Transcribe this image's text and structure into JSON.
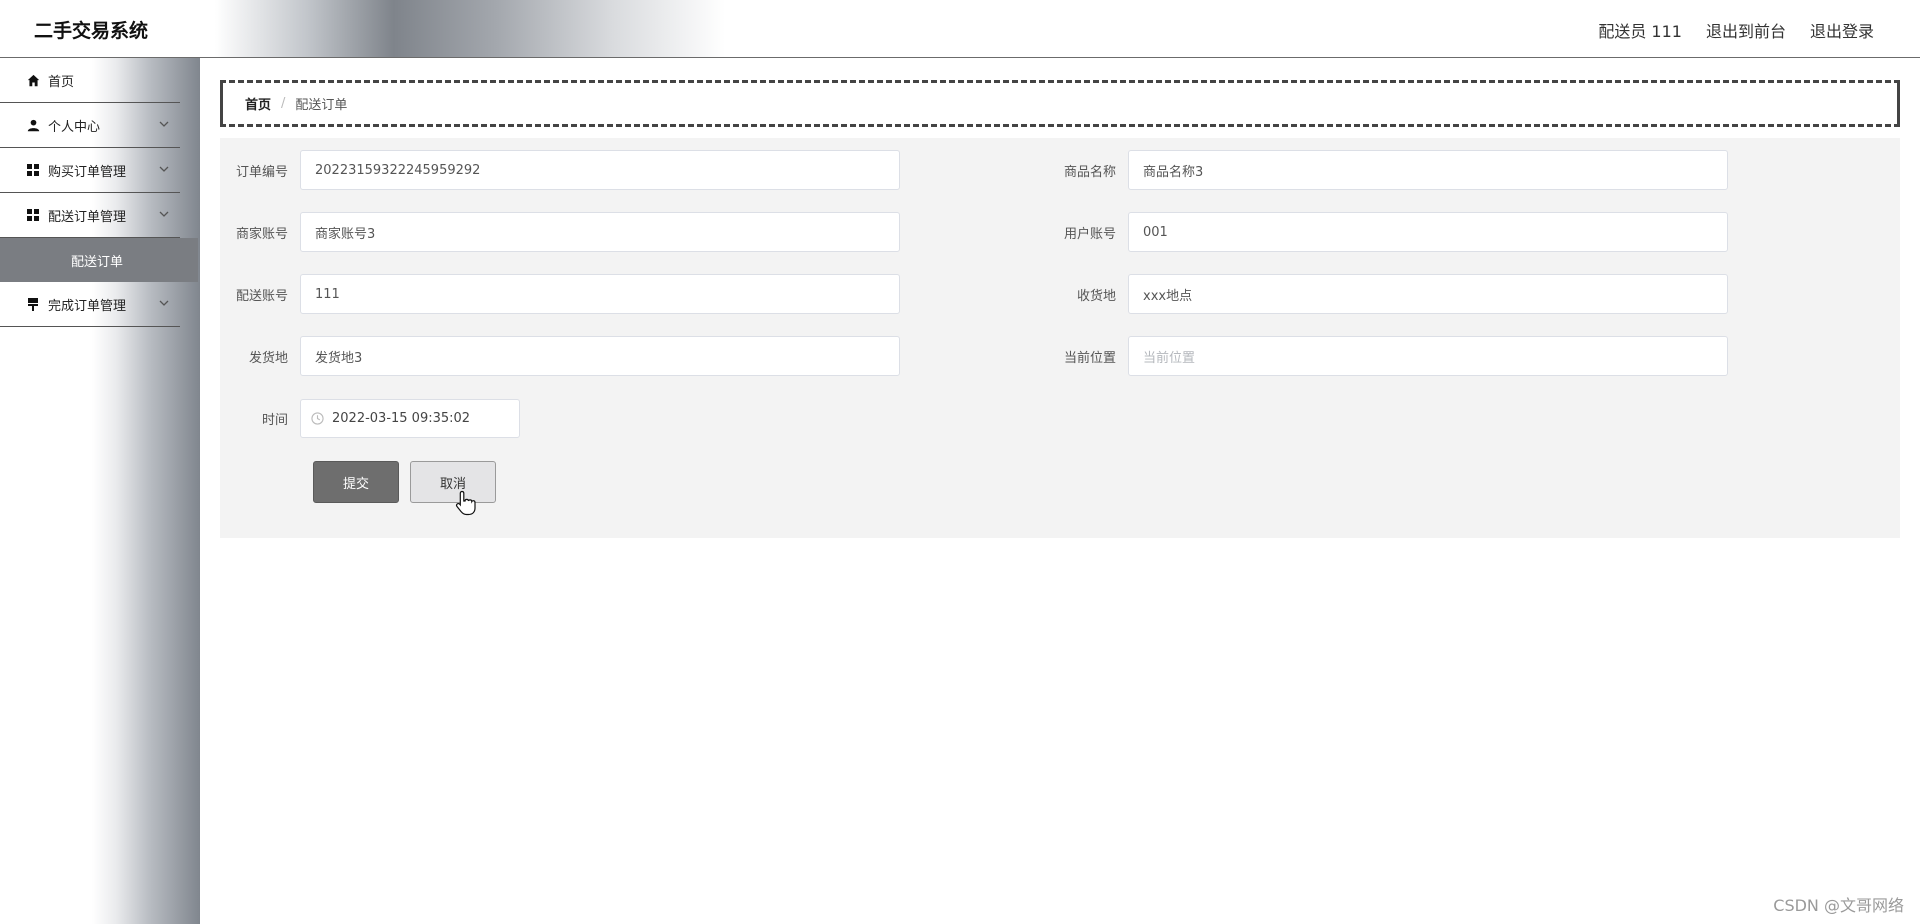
{
  "header": {
    "app_title": "二手交易系统",
    "user_label": "配送员 111",
    "back_to_front": "退出到前台",
    "logout": "退出登录"
  },
  "sidebar": {
    "items": [
      {
        "label": "首页",
        "icon": "home-icon"
      },
      {
        "label": "个人中心",
        "icon": "user-icon"
      },
      {
        "label": "购买订单管理",
        "icon": "grid-icon"
      },
      {
        "label": "配送订单管理",
        "icon": "grid-icon",
        "expanded": true
      },
      {
        "label": "完成订单管理",
        "icon": "flag-icon"
      }
    ],
    "subitem_active": "配送订单"
  },
  "breadcrumb": {
    "home": "首页",
    "separator": "/",
    "current": "配送订单"
  },
  "form": {
    "order_no": {
      "label": "订单编号",
      "value": "20223159322245959292"
    },
    "product_name": {
      "label": "商品名称",
      "value": "商品名称3"
    },
    "merchant_account": {
      "label": "商家账号",
      "value": "商家账号3"
    },
    "user_account": {
      "label": "用户账号",
      "value": "001"
    },
    "delivery_account": {
      "label": "配送账号",
      "value": "111"
    },
    "receive_address": {
      "label": "收货地",
      "value": "xxx地点"
    },
    "ship_address": {
      "label": "发货地",
      "value": "发货地3"
    },
    "current_location": {
      "label": "当前位置",
      "placeholder": "当前位置"
    },
    "time": {
      "label": "时间",
      "value": "2022-03-15 09:35:02"
    },
    "submit_label": "提交",
    "cancel_label": "取消"
  },
  "watermark": "CSDN @文哥网络"
}
